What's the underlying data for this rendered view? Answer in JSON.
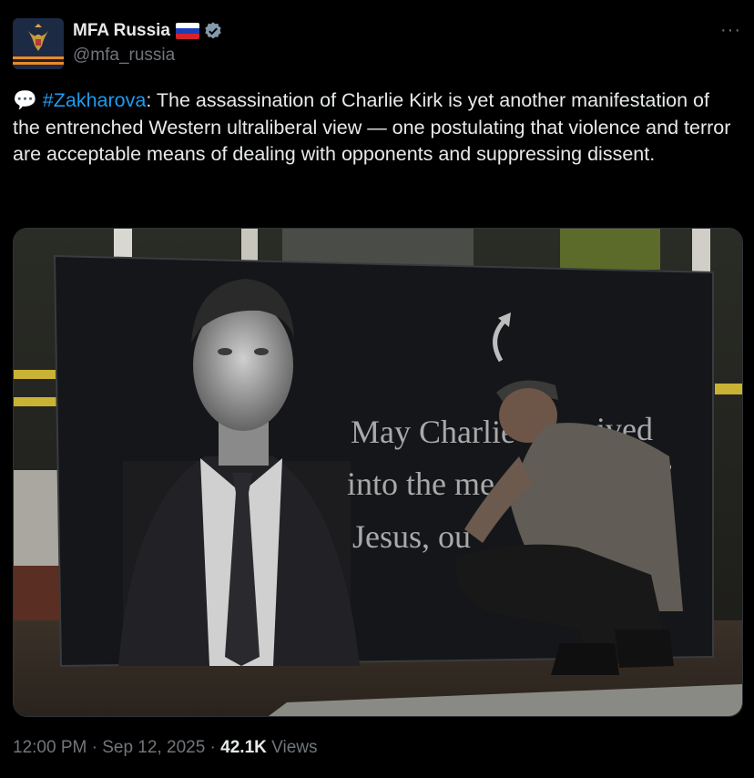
{
  "post": {
    "author": {
      "display_name": "MFA Russia",
      "handle": "@mfa_russia",
      "avatar_icon": "russian-coat-of-arms-icon",
      "flag_icon": "russia-flag-icon",
      "verified_icon": "verified-badge-icon"
    },
    "more_label": "···",
    "text": {
      "bubble": "💬",
      "hashtag": "#Zakharova",
      "body": ": The assassination of Charlie Kirk is yet another manifestation of the entrenched Western ultraliberal view — one postulating that violence and terror are acceptable means of dealing with opponents and suppressing dissent."
    },
    "image": {
      "sign_lines": [
        "May Charlie",
        "ived",
        "into the me",
        "f",
        "Jesus, ou",
        "ino"
      ]
    },
    "footer": {
      "time": "12:00 PM",
      "separator": "·",
      "date": "Sep 12, 2025",
      "views_count": "42.1K",
      "views_label": "Views"
    }
  },
  "colors": {
    "background": "#000000",
    "text": "#e7e9ea",
    "muted": "#71767b",
    "link": "#1d9bf0",
    "verified": "#829aab"
  }
}
